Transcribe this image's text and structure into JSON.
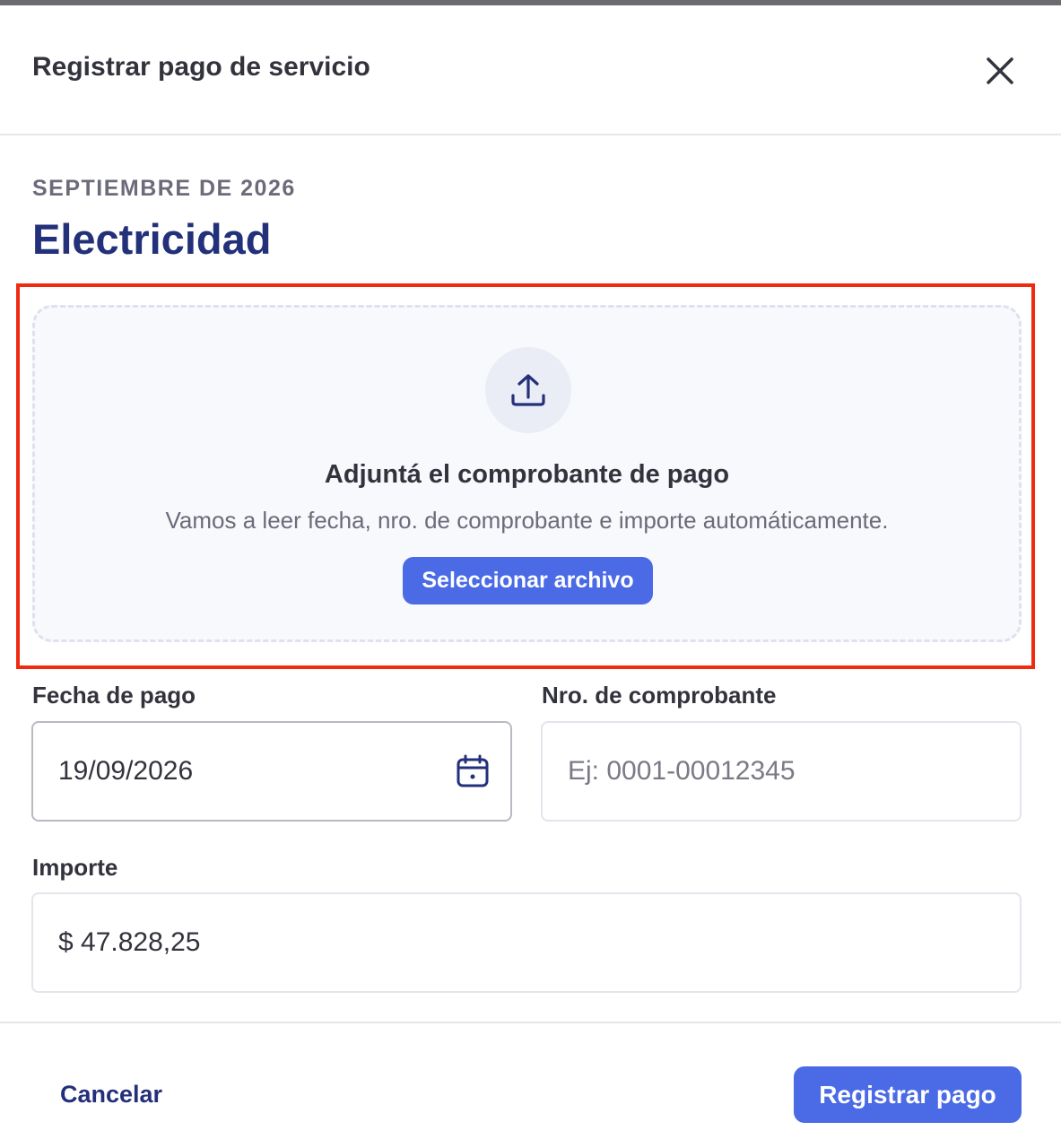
{
  "modal": {
    "title": "Registrar pago de servicio",
    "close_icon": "close-icon"
  },
  "service": {
    "period": "SEPTIEMBRE DE 2026",
    "name": "Electricidad"
  },
  "upload": {
    "icon": "upload-icon",
    "title": "Adjuntá el comprobante de pago",
    "subtitle": "Vamos a leer fecha, nro. de comprobante e importe automáticamente.",
    "button_label": "Seleccionar archivo"
  },
  "form": {
    "date_label": "Fecha de pago",
    "date_value": "19/09/2026",
    "date_icon": "calendar-icon",
    "receipt_label": "Nro. de comprobante",
    "receipt_value": "",
    "receipt_placeholder": "Ej: 0001-00012345",
    "amount_label": "Importe",
    "amount_value": "$ 47.828,25"
  },
  "footer": {
    "cancel_label": "Cancelar",
    "submit_label": "Registrar pago"
  },
  "colors": {
    "primary": "#4a6ae6",
    "heading": "#23307a",
    "highlight": "#f02a10"
  }
}
